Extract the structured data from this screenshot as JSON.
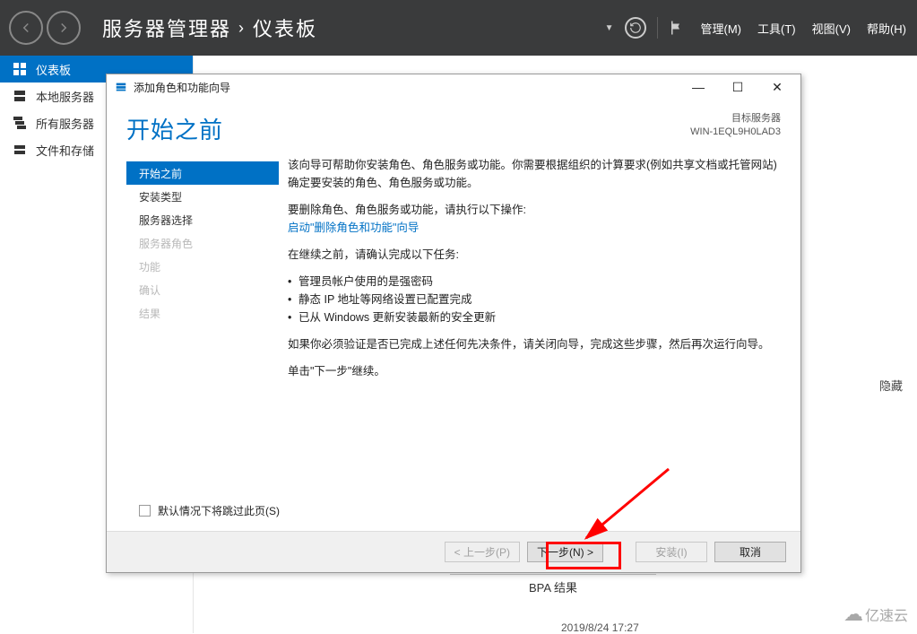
{
  "header": {
    "breadcrumb_app": "服务器管理器",
    "breadcrumb_page": "仪表板",
    "menus": {
      "manage": "管理(M)",
      "tools": "工具(T)",
      "view": "视图(V)",
      "help": "帮助(H)"
    }
  },
  "sidebar": {
    "items": [
      {
        "label": "仪表板"
      },
      {
        "label": "本地服务器"
      },
      {
        "label": "所有服务器"
      },
      {
        "label": "文件和存储"
      }
    ]
  },
  "background": {
    "hide_label": "隐藏",
    "bpa_title": "BPA 结果",
    "bpa_timestamp": "2019/8/24 17:27"
  },
  "wizard": {
    "window_title": "添加角色和功能向导",
    "page_title": "开始之前",
    "target_label": "目标服务器",
    "target_value": "WIN-1EQL9H0LAD3",
    "steps": [
      {
        "label": "开始之前",
        "state": "active"
      },
      {
        "label": "安装类型",
        "state": "enabled"
      },
      {
        "label": "服务器选择",
        "state": "enabled"
      },
      {
        "label": "服务器角色",
        "state": "disabled"
      },
      {
        "label": "功能",
        "state": "disabled"
      },
      {
        "label": "确认",
        "state": "disabled"
      },
      {
        "label": "结果",
        "state": "disabled"
      }
    ],
    "content": {
      "p1": "该向导可帮助你安装角色、角色服务或功能。你需要根据组织的计算要求(例如共享文档或托管网站)确定要安装的角色、角色服务或功能。",
      "p2_prefix": "要删除角色、角色服务或功能，请执行以下操作:",
      "remove_link": "启动\"删除角色和功能\"向导",
      "p3": "在继续之前，请确认完成以下任务:",
      "bullets": [
        "管理员帐户使用的是强密码",
        "静态 IP 地址等网络设置已配置完成",
        "已从 Windows 更新安装最新的安全更新"
      ],
      "p4": "如果你必须验证是否已完成上述任何先决条件，请关闭向导，完成这些步骤，然后再次运行向导。",
      "p5": "单击\"下一步\"继续。"
    },
    "skip_checkbox_label": "默认情况下将跳过此页(S)",
    "buttons": {
      "prev": "< 上一步(P)",
      "next": "下一步(N) >",
      "install": "安装(I)",
      "cancel": "取消"
    }
  },
  "watermark": "亿速云"
}
